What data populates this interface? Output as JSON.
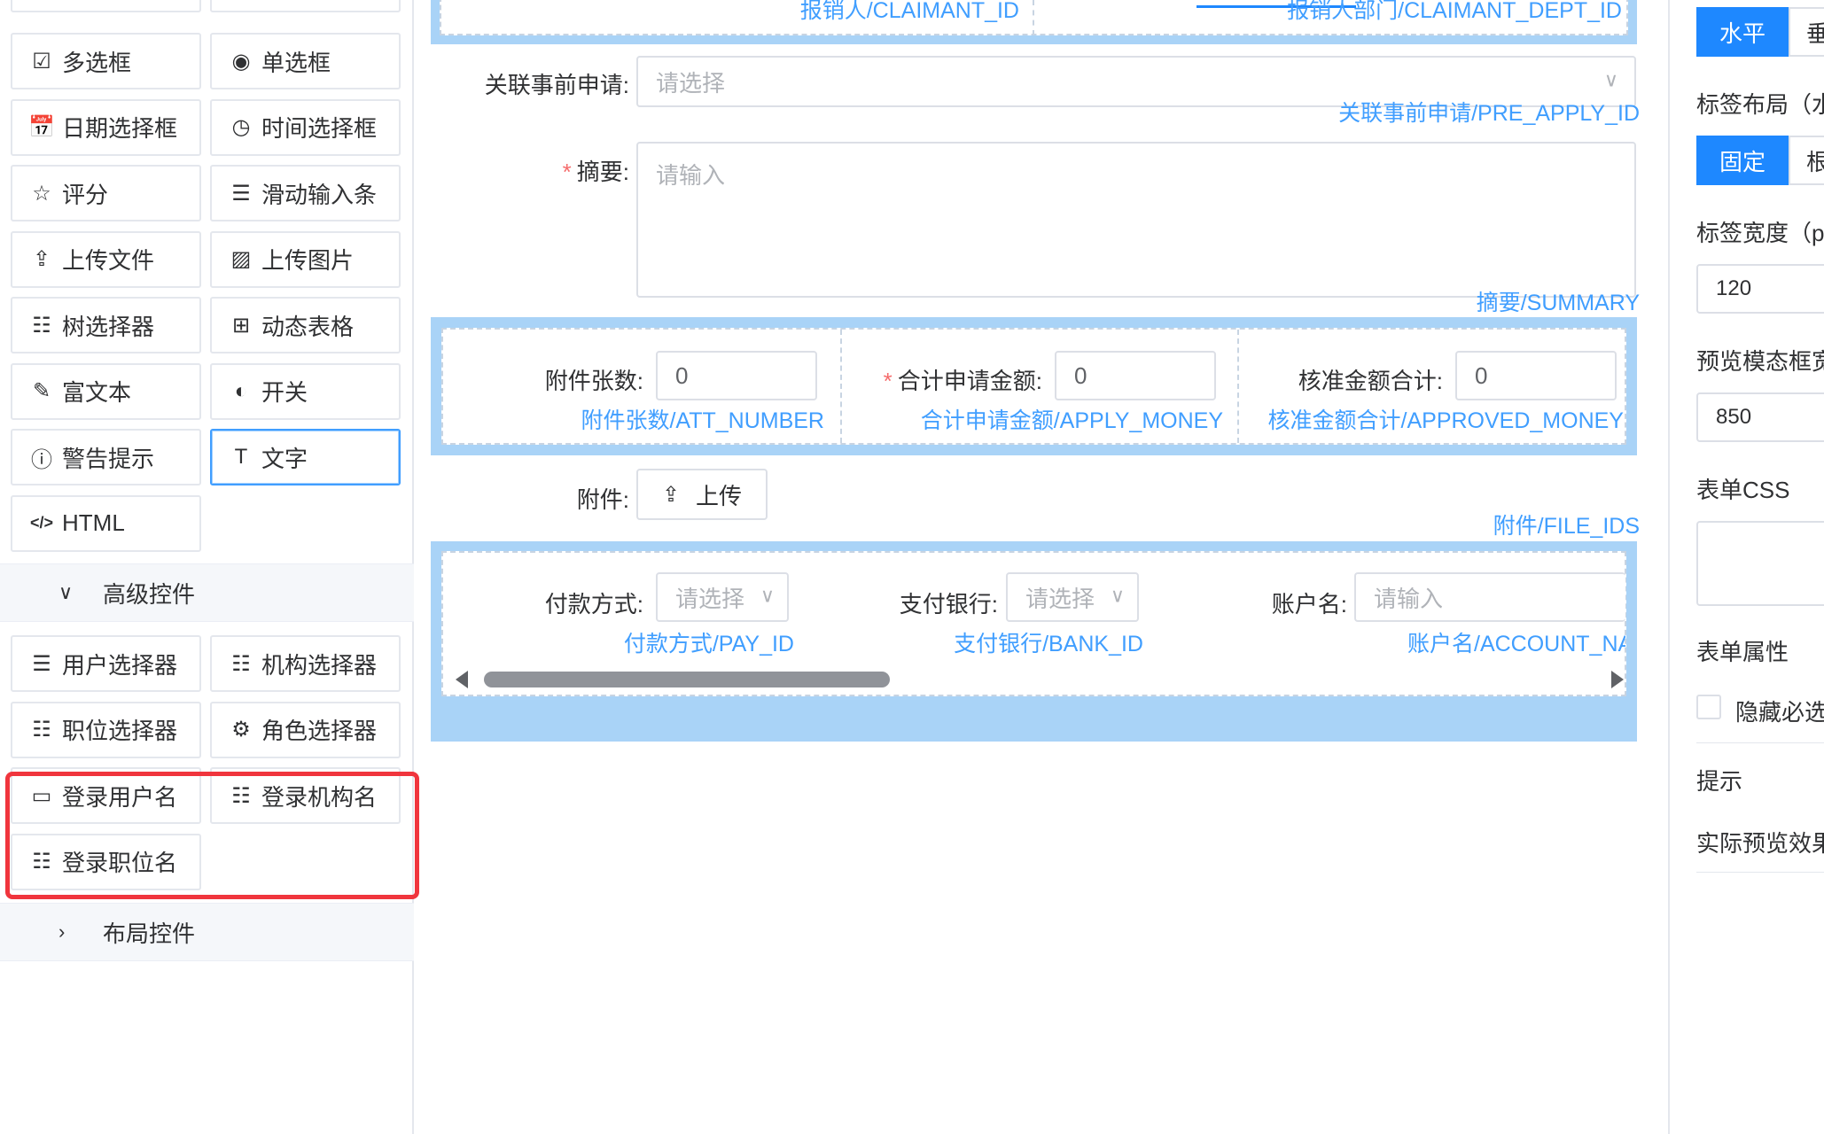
{
  "left_panel": {
    "basic_controls": [
      {
        "label": "多选框",
        "icon": "checkbox-icon",
        "glyph": "☑"
      },
      {
        "label": "单选框",
        "icon": "radio-icon",
        "glyph": "◉"
      },
      {
        "label": "日期选择框",
        "icon": "calendar-check-icon",
        "glyph": "📅"
      },
      {
        "label": "时间选择框",
        "icon": "clock-icon",
        "glyph": "◷"
      },
      {
        "label": "评分",
        "icon": "star-icon",
        "glyph": "☆"
      },
      {
        "label": "滑动输入条",
        "icon": "slider-icon",
        "glyph": "☰"
      },
      {
        "label": "上传文件",
        "icon": "upload-icon",
        "glyph": "⇪"
      },
      {
        "label": "上传图片",
        "icon": "image-icon",
        "glyph": "▨"
      },
      {
        "label": "树选择器",
        "icon": "tree-list-icon",
        "glyph": "☷"
      },
      {
        "label": "动态表格",
        "icon": "table-icon",
        "glyph": "⊞"
      },
      {
        "label": "富文本",
        "icon": "rich-text-icon",
        "glyph": "✎"
      },
      {
        "label": "开关",
        "icon": "toggle-icon",
        "glyph": "◐"
      },
      {
        "label": "警告提示",
        "icon": "alert-icon",
        "glyph": "ⓘ"
      },
      {
        "label": "文字",
        "icon": "text-icon",
        "glyph": "T"
      },
      {
        "label": "HTML",
        "icon": "code-icon",
        "glyph": "</>"
      }
    ],
    "advanced_group": {
      "label": "高级控件",
      "chevron": "∨"
    },
    "advanced_controls": [
      {
        "label": "用户选择器",
        "icon": "user-list-icon",
        "glyph": "☰"
      },
      {
        "label": "机构选择器",
        "icon": "org-tree-icon",
        "glyph": "☷"
      },
      {
        "label": "职位选择器",
        "icon": "position-list-icon",
        "glyph": "☷"
      },
      {
        "label": "角色选择器",
        "icon": "role-chip-icon",
        "glyph": "⚙"
      },
      {
        "label": "登录用户名",
        "icon": "input-box-icon",
        "glyph": "▭"
      },
      {
        "label": "登录机构名",
        "icon": "org-tree-icon",
        "glyph": "☷"
      },
      {
        "label": "登录职位名",
        "icon": "position-list-icon",
        "glyph": "☷"
      }
    ],
    "layout_group": {
      "label": "布局控件",
      "chevron": "›"
    }
  },
  "canvas": {
    "top_field_names": [
      "报销人/CLAIMANT_ID",
      "报销人部门/CLAIMANT_DEPT_ID"
    ],
    "pre_apply": {
      "label": "关联事前申请:",
      "placeholder": "请选择",
      "field": "关联事前申请/PRE_APPLY_ID"
    },
    "summary": {
      "required": "*",
      "label": "摘要:",
      "placeholder": "请输入",
      "field": "摘要/SUMMARY"
    },
    "numbers_row": [
      {
        "required": "",
        "label": "附件张数:",
        "value": "0",
        "field": "附件张数/ATT_NUMBER"
      },
      {
        "required": "*",
        "label": "合计申请金额:",
        "value": "0",
        "field": "合计申请金额/APPLY_MONEY"
      },
      {
        "required": "",
        "label": "核准金额合计:",
        "value": "0",
        "field": "核准金额合计/APPROVED_MONEY"
      }
    ],
    "attachment": {
      "label": "附件:",
      "button": "上传",
      "field": "附件/FILE_IDS"
    },
    "payment_row": [
      {
        "label": "付款方式:",
        "placeholder": "请选择",
        "field": "付款方式/PAY_ID"
      },
      {
        "label": "支付银行:",
        "placeholder": "请选择",
        "field": "支付银行/BANK_ID"
      },
      {
        "label": "账户名:",
        "placeholder": "请输入",
        "field": "账户名/ACCOUNT_NAM"
      }
    ]
  },
  "right_panel": {
    "direction": {
      "on": "水平",
      "off": "垂"
    },
    "label_layout_title": "标签布局（水",
    "label_layout": {
      "on": "固定",
      "off": "根"
    },
    "label_width_title": "标签宽度（px",
    "label_width_value": "120",
    "preview_width_title": "预览模态框宽",
    "preview_width_value": "850",
    "form_css_title": "表单CSS",
    "form_attr_title": "表单属性",
    "hide_required_label": "隐藏必选",
    "tip_title": "提示",
    "preview_effect_title": "实际预览效果"
  },
  "colors": {
    "accent": "#1e88ff",
    "link": "#409eff",
    "highlight": "#f0353d",
    "row_bg": "#a9d3f7"
  }
}
